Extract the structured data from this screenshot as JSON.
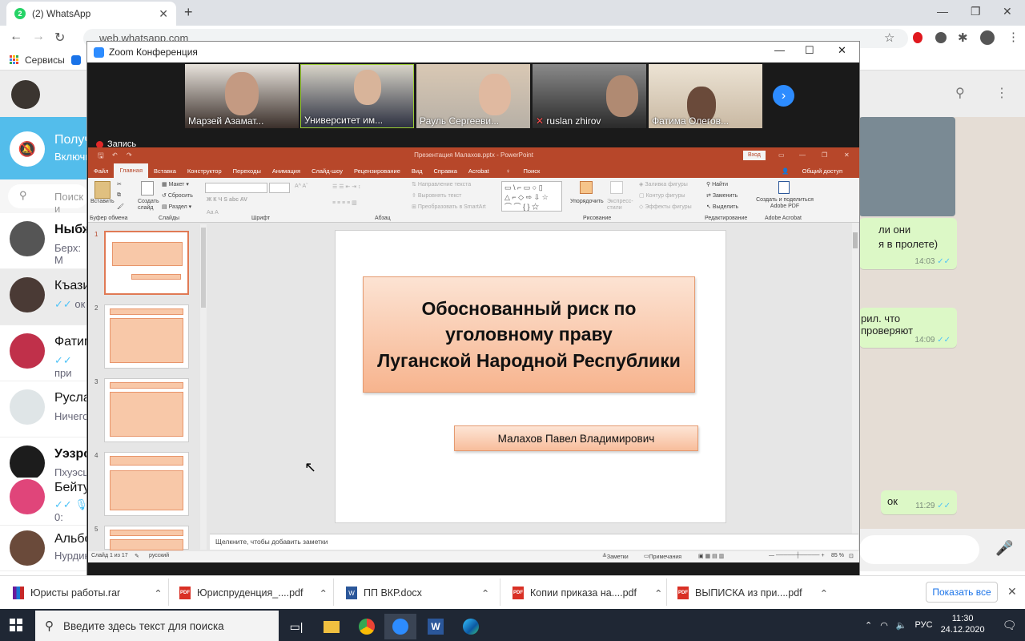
{
  "browser": {
    "tab_title": "(2) WhatsApp",
    "tab_badge": "2",
    "url": "web.whatsapp.com",
    "bookmark_apps": "Сервисы"
  },
  "whatsapp": {
    "notification": {
      "title": "Получ",
      "subtitle": "Включи"
    },
    "search_placeholder": "Поиск и",
    "chats": [
      {
        "name": "Ныбж",
        "preview": "Берх: М"
      },
      {
        "name": "Къази",
        "preview": "ок"
      },
      {
        "name": "Фатим",
        "preview": "при"
      },
      {
        "name": "Руслан",
        "preview": "Ничего"
      },
      {
        "name": "Уэзро",
        "preview": "Пхуэсц"
      },
      {
        "name": "Бейту",
        "preview": "0:"
      },
      {
        "name": "Альбо",
        "preview": "Нурдин"
      }
    ],
    "messages": [
      {
        "text": "ли они\nя в пролете)",
        "time": "14:03"
      },
      {
        "text": "рил. что проверяют",
        "time": "14:09"
      },
      {
        "text": "ок",
        "time": "11:29"
      }
    ]
  },
  "zoom": {
    "title": "Zoom Конференция",
    "recording": "Запись",
    "participants": [
      {
        "name": "Марзей Азамат...",
        "color": "#3a2f2a"
      },
      {
        "name": "Университет им...",
        "color": "#6b6f78"
      },
      {
        "name": "Рауль Сергееви...",
        "color": "#b7b0a6"
      },
      {
        "name": "ruslan zhirov",
        "color": "#4a4a4a"
      },
      {
        "name": "Фатима Олегов...",
        "color": "#c9b9a3"
      }
    ]
  },
  "powerpoint": {
    "title": "Презентация Малахов.pptx - PowerPoint",
    "signin": "Вход",
    "share": "Общий доступ",
    "tabs": [
      "Файл",
      "Главная",
      "Вставка",
      "Конструктор",
      "Переходы",
      "Анимация",
      "Слайд-шоу",
      "Рецензирование",
      "Вид",
      "Справка",
      "Acrobat",
      "Поиск"
    ],
    "ribbon": {
      "paste": "Вставить",
      "clipboard": "Буфер обмена",
      "new_slide": "Создать слайд",
      "layout": "Макет",
      "reset": "Сбросить",
      "section": "Раздел",
      "slides": "Слайды",
      "font": "Шрифт",
      "paragraph": "Абзац",
      "text_dir": "Направление текста",
      "align_text": "Выровнять текст",
      "smartart": "Преобразовать в SmartArt",
      "arrange": "Упорядочить",
      "quick_styles": "Экспресс-стили",
      "fill": "Заливка фигуры",
      "outline": "Контур фигуры",
      "effects": "Эффекты фигуры",
      "drawing": "Рисование",
      "find": "Найти",
      "replace": "Заменить",
      "select": "Выделить",
      "editing": "Редактирование",
      "acrobat_btn": "Создать и поделиться Adobe PDF",
      "acrobat": "Adobe Acrobat"
    },
    "slide_numbers": [
      "1",
      "2",
      "3",
      "4",
      "5"
    ],
    "slide": {
      "title": "Обоснованный риск по\nуголовному праву\nЛуганской Народной Республики",
      "subtitle": "Малахов Павел Владимирович"
    },
    "notes_placeholder": "Щелкните, чтобы добавить заметки",
    "status": {
      "slide": "Слайд 1 из 17",
      "lang": "русский",
      "notes": "Заметки",
      "comments": "Примечания",
      "zoom": "85 %"
    }
  },
  "downloads": [
    {
      "name": "Юристы работы.rar"
    },
    {
      "name": "Юриспруденция_....pdf"
    },
    {
      "name": "ПП ВКР.docx"
    },
    {
      "name": "Копии приказа на....pdf"
    },
    {
      "name": "ВЫПИСКА из при....pdf"
    }
  ],
  "downloads_show_all": "Показать все",
  "taskbar": {
    "search_placeholder": "Введите здесь текст для поиска",
    "lang": "РУС",
    "time": "11:30",
    "date": "24.12.2020"
  }
}
